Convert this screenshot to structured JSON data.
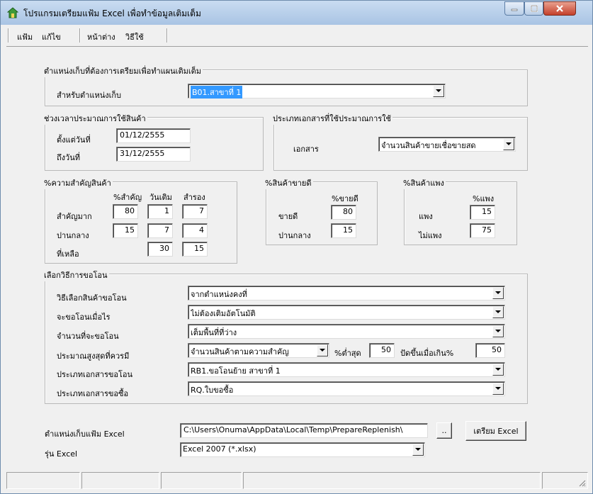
{
  "window": {
    "title": "โปรแกรมเตรียมแฟ้ม Excel เพื่อทำข้อมูลเติมเต็ม"
  },
  "menu": {
    "items": [
      "แฟ้ม",
      "แก้ไข",
      "หน้าต่าง",
      "วิธีใช้"
    ]
  },
  "location_group": {
    "legend": "ตำแหน่งเก็บที่ต้องการเตรียมเพื่อทำแผนเติมเต็ม",
    "label": "สำหรับตำแหน่งเก็บ",
    "value": "B01.สาขาที่ 1"
  },
  "period_group": {
    "legend": "ช่วงเวลาประมาณการใช้สินค้า",
    "from_label": "ตั้งแต่วันที่",
    "from_value": "01/12/2555",
    "to_label": "ถึงวันที่",
    "to_value": "31/12/2555"
  },
  "doctype_group": {
    "legend": "ประเภทเอกสารที่ใช้ประมาณการใช้",
    "label": "เอกสาร",
    "value": "จำนวนสินค้าขายเชื่อขายสด"
  },
  "importance_group": {
    "legend": "%ความสำคัญสินค้า",
    "headers": [
      "%สำคัญ",
      "วันเติม",
      "สำรอง"
    ],
    "rows": [
      {
        "label": "สำคัญมาก",
        "values": [
          "80",
          "1",
          "7"
        ]
      },
      {
        "label": "ปานกลาง",
        "values": [
          "15",
          "7",
          "4"
        ]
      },
      {
        "label": "ที่เหลือ",
        "values": [
          "",
          "30",
          "15"
        ]
      }
    ]
  },
  "bestseller_group": {
    "legend": "%สินค้าขายดี",
    "header": "%ขายดี",
    "rows": [
      {
        "label": "ขายดี",
        "value": "80"
      },
      {
        "label": "ปานกลาง",
        "value": "15"
      }
    ]
  },
  "expensive_group": {
    "legend": "%สินค้าแพง",
    "header": "%แพง",
    "rows": [
      {
        "label": "แพง",
        "value": "15"
      },
      {
        "label": "ไม่แพง",
        "value": "75"
      }
    ]
  },
  "transfer_group": {
    "legend": "เลือกวิธีการขอโอน",
    "rows": [
      {
        "label": "วิธีเลือกสินค้าขอโอน",
        "value": "จากตำแหน่งคงที่"
      },
      {
        "label": "จะขอโอนเมื่อไร",
        "value": "ไม่ต้องเติมอัตโนมัติ"
      },
      {
        "label": "จำนวนที่จะขอโอน",
        "value": "เต็มพื้นที่ที่ว่าง"
      },
      {
        "label": "ประมาณสูงสุดที่ควรมี",
        "value": "จำนวนสินค้าตามความสำคัญ"
      },
      {
        "label": "ประเภทเอกสารขอโอน",
        "value": "RB1.ขอโอนย้าย สาขาที่ 1"
      },
      {
        "label": "ประเภทเอกสารขอซื้อ",
        "value": "RQ.ใบขอซื้อ"
      }
    ],
    "min_pct_label": "%ต่ำสุด",
    "min_pct_value": "50",
    "roundup_label": "ปัดขึ้นเมื่อเกิน%",
    "roundup_value": "50"
  },
  "excel": {
    "path_label": "ตำแหน่งเก็บแฟ้ม Excel",
    "path_value": "C:\\Users\\Onuma\\AppData\\Local\\Temp\\PrepareReplenish\\",
    "browse_label": "..",
    "prepare_label": "เตรียม Excel",
    "version_label": "รุ่น Excel",
    "version_value": "Excel 2007 (*.xlsx)"
  }
}
